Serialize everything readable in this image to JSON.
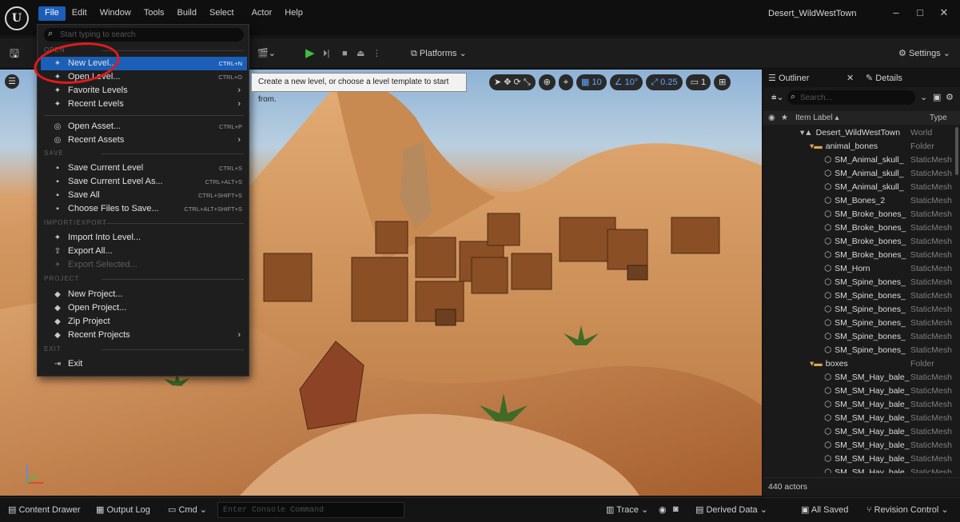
{
  "window": {
    "project_name": "Desert_WildWestTown",
    "minimize": "–",
    "maximize": "□",
    "close": "✕"
  },
  "menubar": {
    "items": [
      "File",
      "Edit",
      "Window",
      "Tools",
      "Build",
      "Select",
      "Actor",
      "Help"
    ]
  },
  "toolbar": {
    "platforms_label": "Platforms",
    "settings_label": "Settings"
  },
  "file_menu": {
    "search_placeholder": "Start typing to search",
    "sections": {
      "open": "OPEN",
      "save": "SAVE",
      "import_export": "IMPORT/EXPORT",
      "project": "PROJECT",
      "exit": "EXIT"
    },
    "items": {
      "new_level": {
        "label": "New Level...",
        "shortcut": "CTRL+N"
      },
      "open_level": {
        "label": "Open Level...",
        "shortcut": "CTRL+O"
      },
      "favorite_levels": {
        "label": "Favorite Levels"
      },
      "recent_levels": {
        "label": "Recent Levels"
      },
      "open_asset": {
        "label": "Open Asset...",
        "shortcut": "CTRL+P"
      },
      "recent_assets": {
        "label": "Recent Assets"
      },
      "save_current_level": {
        "label": "Save Current Level",
        "shortcut": "CTRL+S"
      },
      "save_current_level_as": {
        "label": "Save Current Level As...",
        "shortcut": "CTRL+ALT+S"
      },
      "save_all": {
        "label": "Save All",
        "shortcut": "CTRL+SHIFT+S"
      },
      "choose_files": {
        "label": "Choose Files to Save...",
        "shortcut": "CTRL+ALT+SHIFT+S"
      },
      "import_into_level": {
        "label": "Import Into Level..."
      },
      "export_all": {
        "label": "Export All..."
      },
      "export_selected": {
        "label": "Export Selected..."
      },
      "new_project": {
        "label": "New Project..."
      },
      "open_project": {
        "label": "Open Project..."
      },
      "zip_project": {
        "label": "Zip Project"
      },
      "recent_projects": {
        "label": "Recent Projects"
      },
      "exit": {
        "label": "Exit"
      }
    }
  },
  "tooltip": {
    "text": "Create a new level, or choose a level template to start from."
  },
  "viewport_tools": {
    "grid_snap": "10",
    "rotation_snap": "10°",
    "scale_snap": "0.25",
    "camera_speed": "1"
  },
  "outliner": {
    "tab_outliner": "Outliner",
    "tab_details": "Details",
    "search_placeholder": "Search...",
    "col_label": "Item Label ▴",
    "col_type": "Type",
    "rows": [
      {
        "label": "Desert_WildWestTown",
        "type": "World",
        "indent": 0,
        "kind": "world"
      },
      {
        "label": "animal_bones",
        "type": "Folder",
        "indent": 1,
        "kind": "folder"
      },
      {
        "label": "SM_Animal_skull_",
        "type": "StaticMesh",
        "indent": 2,
        "kind": "mesh"
      },
      {
        "label": "SM_Animal_skull_",
        "type": "StaticMesh",
        "indent": 2,
        "kind": "mesh"
      },
      {
        "label": "SM_Animal_skull_",
        "type": "StaticMesh",
        "indent": 2,
        "kind": "mesh"
      },
      {
        "label": "SM_Bones_2",
        "type": "StaticMesh",
        "indent": 2,
        "kind": "mesh"
      },
      {
        "label": "SM_Broke_bones_",
        "type": "StaticMesh",
        "indent": 2,
        "kind": "mesh"
      },
      {
        "label": "SM_Broke_bones_",
        "type": "StaticMesh",
        "indent": 2,
        "kind": "mesh"
      },
      {
        "label": "SM_Broke_bones_",
        "type": "StaticMesh",
        "indent": 2,
        "kind": "mesh"
      },
      {
        "label": "SM_Broke_bones_",
        "type": "StaticMesh",
        "indent": 2,
        "kind": "mesh"
      },
      {
        "label": "SM_Horn",
        "type": "StaticMesh",
        "indent": 2,
        "kind": "mesh"
      },
      {
        "label": "SM_Spine_bones_",
        "type": "StaticMesh",
        "indent": 2,
        "kind": "mesh"
      },
      {
        "label": "SM_Spine_bones_",
        "type": "StaticMesh",
        "indent": 2,
        "kind": "mesh"
      },
      {
        "label": "SM_Spine_bones_",
        "type": "StaticMesh",
        "indent": 2,
        "kind": "mesh"
      },
      {
        "label": "SM_Spine_bones_",
        "type": "StaticMesh",
        "indent": 2,
        "kind": "mesh"
      },
      {
        "label": "SM_Spine_bones_",
        "type": "StaticMesh",
        "indent": 2,
        "kind": "mesh"
      },
      {
        "label": "SM_Spine_bones_",
        "type": "StaticMesh",
        "indent": 2,
        "kind": "mesh"
      },
      {
        "label": "boxes",
        "type": "Folder",
        "indent": 1,
        "kind": "folder"
      },
      {
        "label": "SM_SM_Hay_bale_",
        "type": "StaticMesh",
        "indent": 2,
        "kind": "mesh"
      },
      {
        "label": "SM_SM_Hay_bale_",
        "type": "StaticMesh",
        "indent": 2,
        "kind": "mesh"
      },
      {
        "label": "SM_SM_Hay_bale_",
        "type": "StaticMesh",
        "indent": 2,
        "kind": "mesh"
      },
      {
        "label": "SM_SM_Hay_bale_",
        "type": "StaticMesh",
        "indent": 2,
        "kind": "mesh"
      },
      {
        "label": "SM_SM_Hay_bale_",
        "type": "StaticMesh",
        "indent": 2,
        "kind": "mesh"
      },
      {
        "label": "SM_SM_Hay_bale_",
        "type": "StaticMesh",
        "indent": 2,
        "kind": "mesh"
      },
      {
        "label": "SM_SM_Hay_bale_",
        "type": "StaticMesh",
        "indent": 2,
        "kind": "mesh"
      },
      {
        "label": "SM_SM_Hay_bale_",
        "type": "StaticMesh",
        "indent": 2,
        "kind": "mesh"
      }
    ],
    "actor_count": "440 actors"
  },
  "statusbar": {
    "content_drawer": "Content Drawer",
    "output_log": "Output Log",
    "cmd": "Cmd",
    "console_placeholder": "Enter Console Command",
    "trace": "Trace",
    "derived_data": "Derived Data",
    "all_saved": "All Saved",
    "revision_control": "Revision Control"
  },
  "colors": {
    "menu_highlight": "#1b5fb8",
    "play_green": "#3fbe3f",
    "annotation_red": "#e01b1b"
  }
}
